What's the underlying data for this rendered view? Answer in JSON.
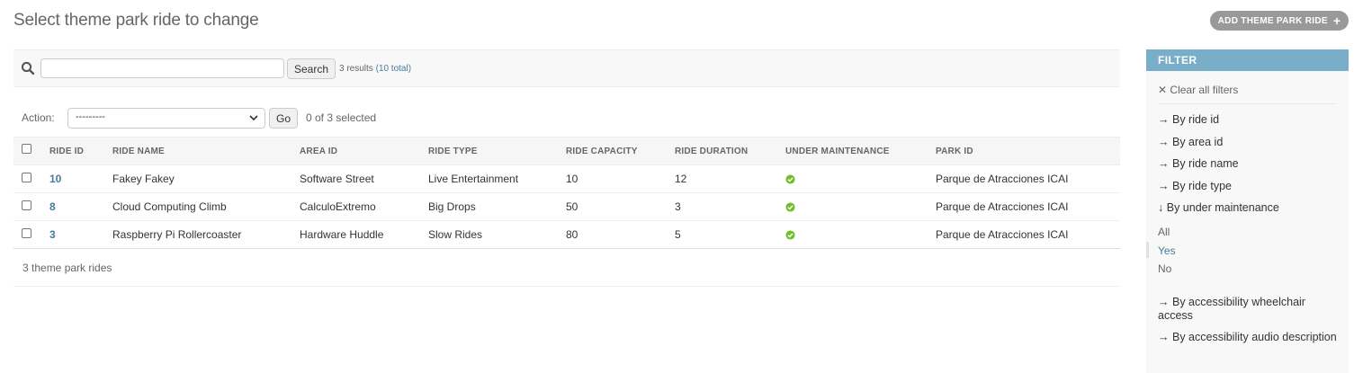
{
  "header": {
    "title": "Select theme park ride to change",
    "add_button": "ADD THEME PARK RIDE"
  },
  "search": {
    "value": "",
    "placeholder": "",
    "button": "Search",
    "results": "3 results",
    "total": "(10 total)"
  },
  "actions": {
    "label": "Action:",
    "selected_option": "---------",
    "go": "Go",
    "selected_count": "0 of 3 selected"
  },
  "table": {
    "headers": [
      "RIDE ID",
      "RIDE NAME",
      "AREA ID",
      "RIDE TYPE",
      "RIDE CAPACITY",
      "RIDE DURATION",
      "UNDER MAINTENANCE",
      "PARK ID"
    ],
    "rows": [
      {
        "ride_id": "10",
        "ride_name": "Fakey Fakey",
        "area_id": "Software Street",
        "ride_type": "Live Entertainment",
        "capacity": "10",
        "duration": "12",
        "under_maintenance": true,
        "park_id": "Parque de Atracciones ICAI"
      },
      {
        "ride_id": "8",
        "ride_name": "Cloud Computing Climb",
        "area_id": "CalculoExtremo",
        "ride_type": "Big Drops",
        "capacity": "50",
        "duration": "3",
        "under_maintenance": true,
        "park_id": "Parque de Atracciones ICAI"
      },
      {
        "ride_id": "3",
        "ride_name": "Raspberry Pi Rollercoaster",
        "area_id": "Hardware Huddle",
        "ride_type": "Slow Rides",
        "capacity": "80",
        "duration": "5",
        "under_maintenance": true,
        "park_id": "Parque de Atracciones ICAI"
      }
    ],
    "footer": "3 theme park rides"
  },
  "filter": {
    "title": "FILTER",
    "clear": "Clear all filters",
    "items": [
      {
        "arrow": "→",
        "label": "By ride id"
      },
      {
        "arrow": "→",
        "label": "By area id"
      },
      {
        "arrow": "→",
        "label": "By ride name"
      },
      {
        "arrow": "→",
        "label": "By ride type"
      },
      {
        "arrow": "↓",
        "label": "By under maintenance"
      }
    ],
    "choices": [
      "All",
      "Yes",
      "No"
    ],
    "selected_choice": "Yes",
    "more_items": [
      {
        "arrow": "→",
        "label": "By accessibility wheelchair access"
      },
      {
        "arrow": "→",
        "label": "By accessibility audio description"
      }
    ]
  },
  "colors": {
    "link": "#447e9b",
    "filter_header": "#79aec8",
    "check_green": "#70bf2b"
  },
  "icons": {
    "search": "search-icon",
    "add": "plus-icon",
    "clear": "close-icon",
    "maintenance": "check-circle-icon"
  }
}
